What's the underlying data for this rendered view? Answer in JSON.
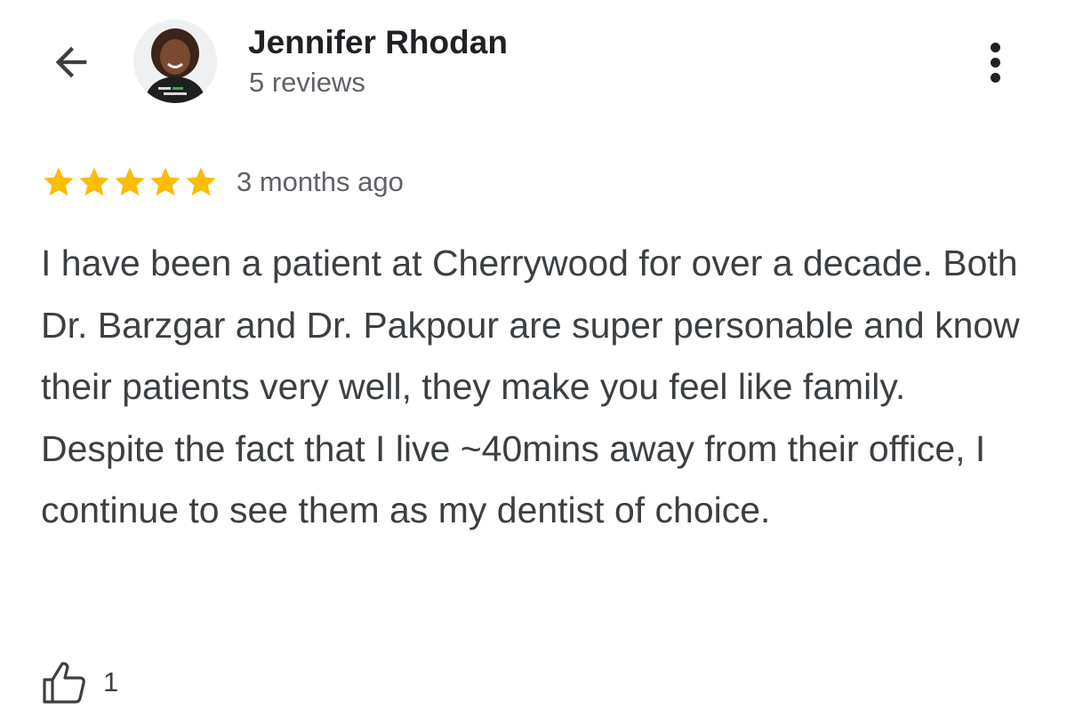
{
  "header": {
    "back_icon": "arrow-back-icon",
    "reviewer": {
      "name": "Jennifer Rhodan",
      "review_count": "5 reviews",
      "avatar_icon": "user-avatar-photo"
    },
    "more_icon": "more-vert-icon"
  },
  "review": {
    "rating": 5,
    "rating_max": 5,
    "star_color": "#FBBC04",
    "time": "3 months ago",
    "text": "I have been a patient at Cherrywood for over a decade. Both Dr. Barzgar and Dr. Pakpour are super personable and know their patients very well, they make you feel like family. Despite the fact that I live ~40mins away from their office, I continue to see them as my dentist of choice."
  },
  "actions": {
    "like_icon": "thumb-up-icon",
    "like_count": "1"
  }
}
